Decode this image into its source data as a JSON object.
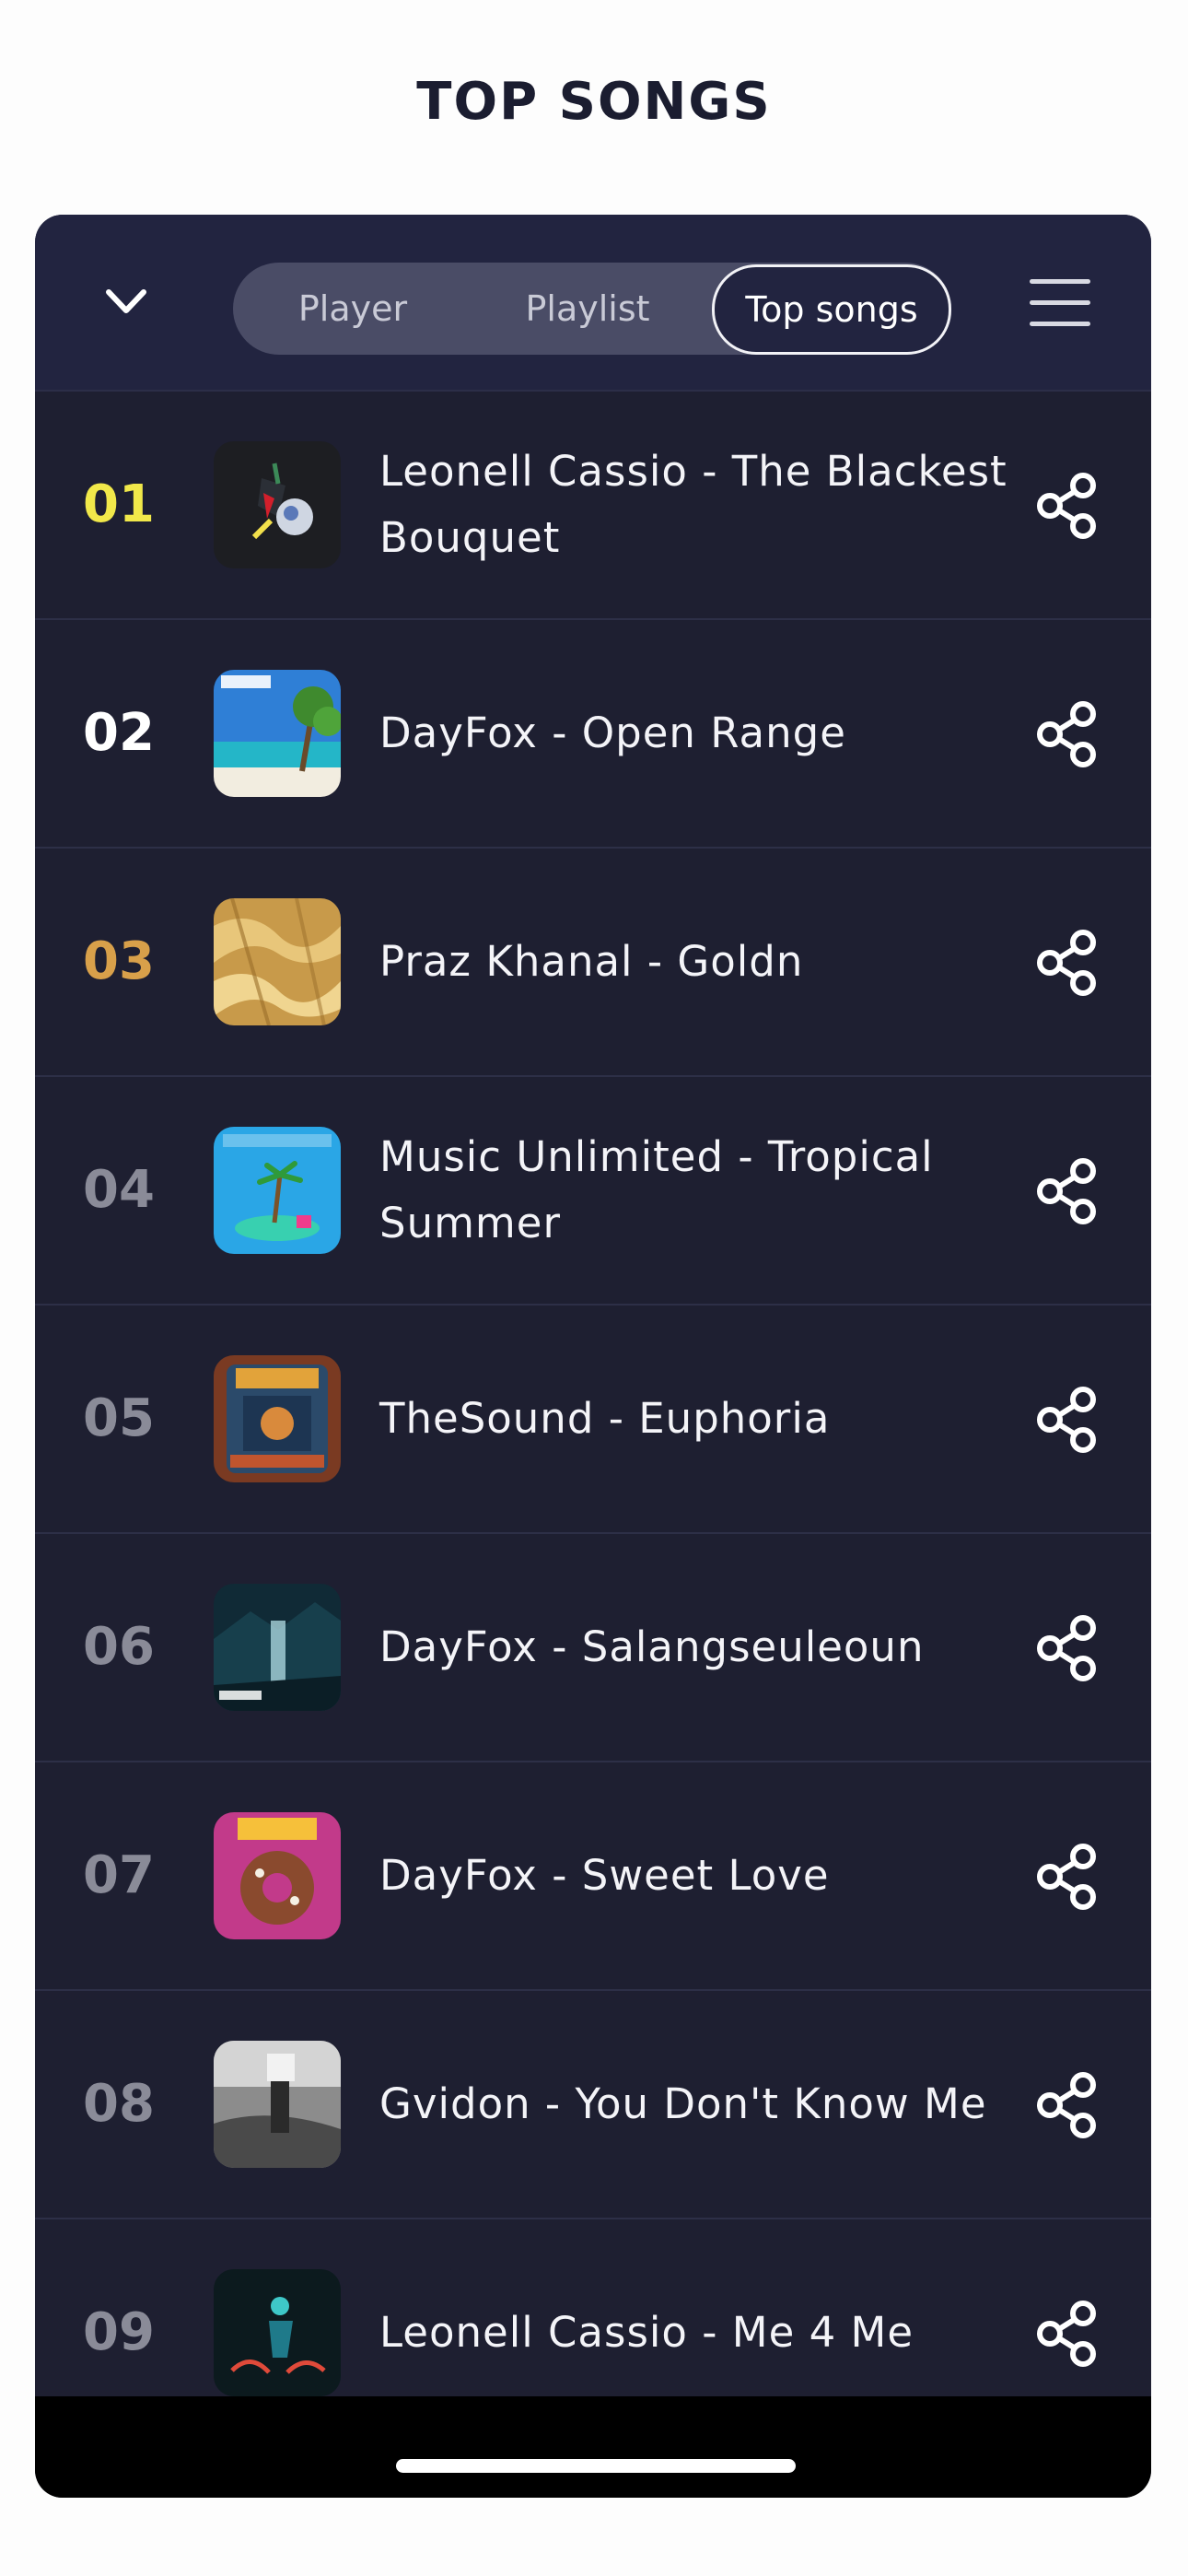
{
  "page": {
    "title": "TOP SONGS"
  },
  "header": {
    "tabs": [
      {
        "label": "Player",
        "active": false
      },
      {
        "label": "Playlist",
        "active": false
      },
      {
        "label": "Top songs",
        "active": true
      }
    ]
  },
  "songs": [
    {
      "rank": "01",
      "title": "Leonell Cassio  -  The Blackest Bouquet"
    },
    {
      "rank": "02",
      "title": "DayFox  -  Open Range"
    },
    {
      "rank": "03",
      "title": "Praz Khanal  -  Goldn"
    },
    {
      "rank": "04",
      "title": "Music Unlimited  -  Tropical Summer"
    },
    {
      "rank": "05",
      "title": "TheSound  -  Euphoria"
    },
    {
      "rank": "06",
      "title": "DayFox  -  Salangseuleoun"
    },
    {
      "rank": "07",
      "title": "DayFox  -  Sweet Love"
    },
    {
      "rank": "08",
      "title": "Gvidon  -  You Don't Know Me"
    },
    {
      "rank": "09",
      "title": "Leonell Cassio - Me 4 Me"
    }
  ],
  "colors": {
    "panel_bg": "#1e1f31",
    "rank_first": "#f1e84a",
    "rank_second": "#ffffff",
    "rank_third": "#d8a04a",
    "rank_other": "#8a8b98"
  }
}
